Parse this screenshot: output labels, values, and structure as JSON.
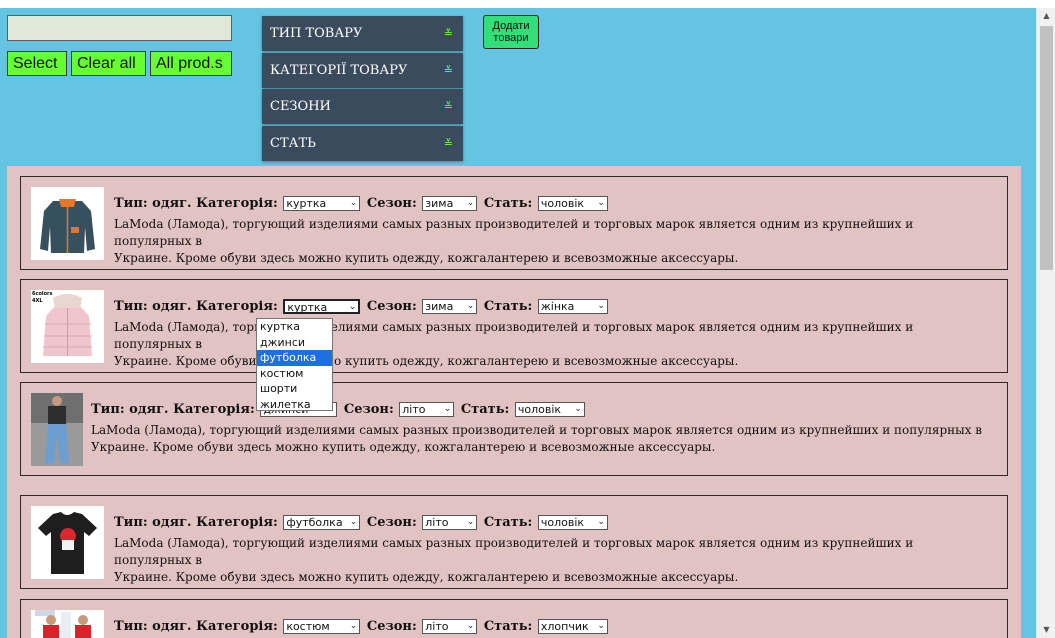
{
  "search": {
    "value": ""
  },
  "buttons": {
    "select": "Select",
    "clear_all": "Clear all",
    "all_products": "All prod.s"
  },
  "add_button": {
    "line1": "Додати",
    "line2": "товари"
  },
  "filters": [
    {
      "label": "ТИП ТОВАРУ"
    },
    {
      "label": "КАТЕГОРІЇ ТОВАРУ"
    },
    {
      "label": "СЕЗОНИ"
    },
    {
      "label": "СТАТЬ"
    }
  ],
  "chevron_glyph": "≚",
  "select_arrow": "⌄",
  "card_labels": {
    "type": "Тип: одяг.",
    "category": "Категорія:",
    "season": "Сезон:",
    "sex": "Стать:"
  },
  "products": [
    {
      "image": "jacket-photo",
      "category": "куртка",
      "season": "зима",
      "sex": "чоловік",
      "desc_line1": "LaModa (Ламода), торгующий изделиями самых разных производителей и торговых марок является одним из крупнейших и популярных в",
      "desc_line2": "Украине. Кроме обуви здесь можно купить одежду, кожгалантерею и всевозможные аксессуары."
    },
    {
      "image": "pink-jacket-photo",
      "image_caption": "6colors 4XL",
      "category": "куртка",
      "season": "зима",
      "sex": "жінка",
      "desc_line1": "LaModa (Ламода), торгующий изделиями самых разных производителей и торговых марок является одним из крупнейших и популярных в",
      "desc_line2": "Украине. Кроме обуви здесь можно купить одежду, кожгалантерею и всевозможные аксессуары."
    },
    {
      "image": "jeans-photo",
      "category": "джинси",
      "season": "літо",
      "sex": "чоловік",
      "desc_line1": "LaModa (Ламода), торгующий изделиями самых разных производителей и торговых марок является одним из крупнейших и популярных в",
      "desc_line2": "Украине. Кроме обуви здесь можно купить одежду, кожгалантерею и всевозможные аксессуары."
    },
    {
      "image": "tshirt-photo",
      "category": "футболка",
      "season": "літо",
      "sex": "чоловік",
      "desc_line1": "LaModa (Ламода), торгующий изделиями самых разных производителей и торговых марок является одним из крупнейших и популярных в",
      "desc_line2": "Украине. Кроме обуви здесь можно купить одежду, кожгалантерею и всевозможные аксессуары."
    },
    {
      "image": "costume-photo",
      "category": "костюм",
      "season": "літо",
      "sex": "хлопчик"
    }
  ],
  "dropdown": {
    "options": [
      "куртка",
      "джинси",
      "футболка",
      "костюм",
      "шорти",
      "жилетка"
    ],
    "highlighted": "футболка"
  },
  "scrollbar": {
    "up": "▲",
    "down": "▼"
  }
}
